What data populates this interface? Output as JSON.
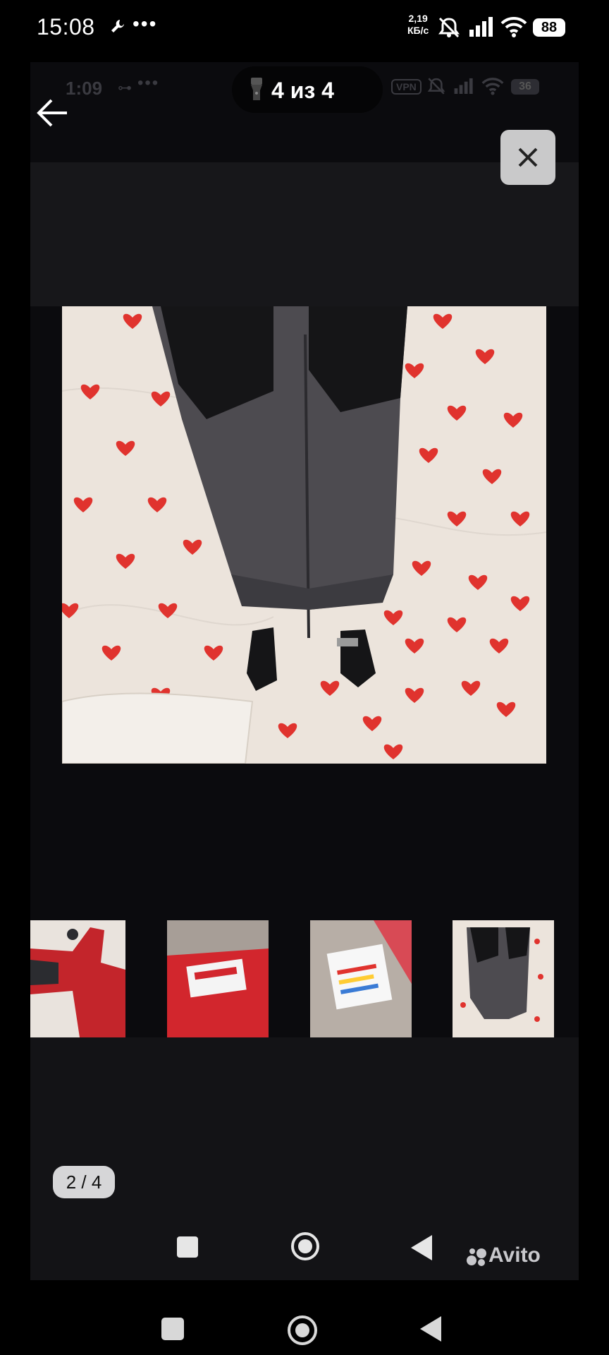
{
  "status_bar": {
    "time": "15:08",
    "wrench_icon": "wrench-icon",
    "more": "•••",
    "net_speed_value": "2,19",
    "net_speed_unit": "КБ/с",
    "battery": "88"
  },
  "inner_status_bar": {
    "time": "1:09",
    "key": "⊶",
    "more": "•••",
    "vpn": "VPN",
    "battery": "36"
  },
  "viewer": {
    "counter": "4 из 4",
    "page_badge": "2 / 4"
  },
  "thumbnails": [
    {
      "name": "red-jacket"
    },
    {
      "name": "jacket-label"
    },
    {
      "name": "care-tag"
    },
    {
      "name": "grey-pants"
    }
  ],
  "branding": {
    "avito": "Avito"
  },
  "colors": {
    "background": "#0b0b0e",
    "band_grey": "#17171a",
    "heart_red": "#e0332e",
    "sheet": "#ece4dc",
    "pants_grey": "#4d4b50"
  }
}
